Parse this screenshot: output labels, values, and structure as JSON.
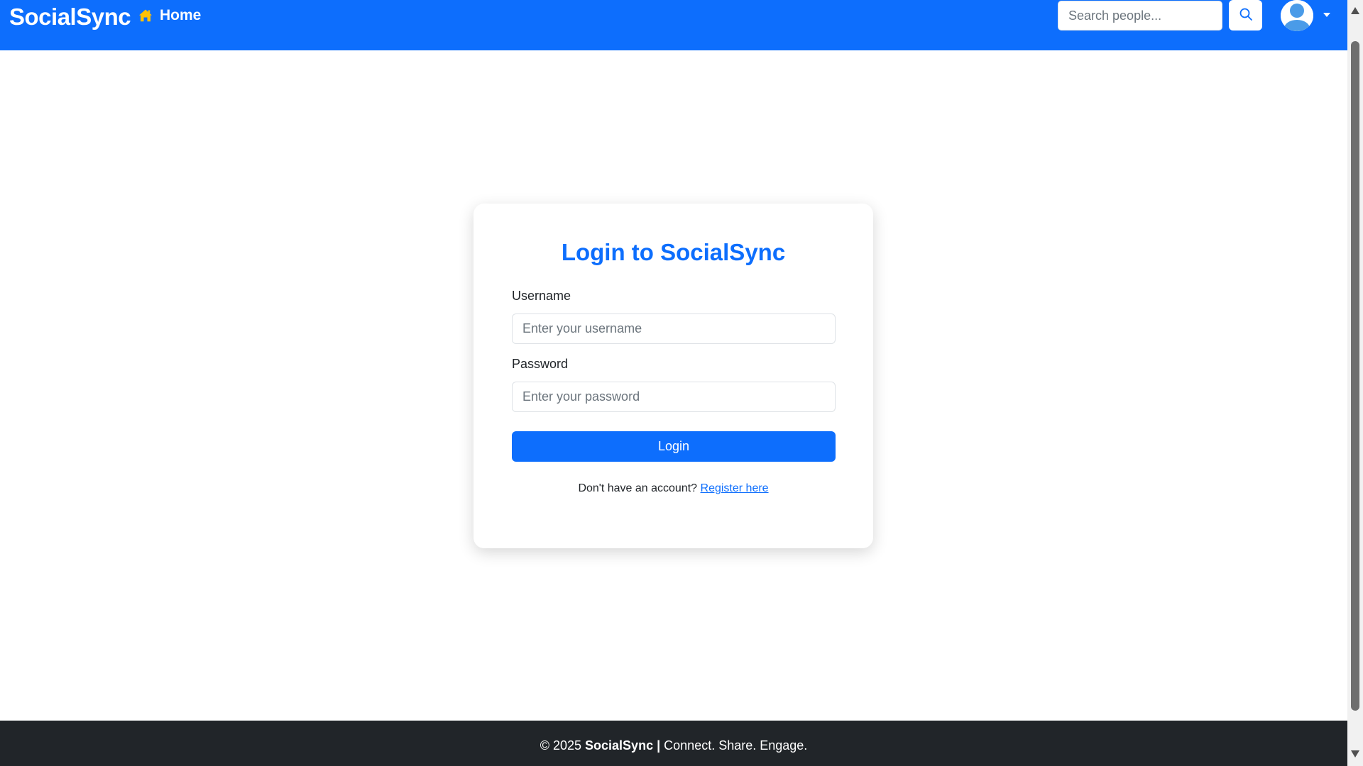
{
  "navbar": {
    "brand": "SocialSync",
    "home_label": "Home",
    "home_icon": "house-icon",
    "search_placeholder": "Search people...",
    "search_icon": "search-icon",
    "avatar_icon": "user-avatar-icon",
    "dropdown_icon": "caret-down-icon"
  },
  "login": {
    "title": "Login to SocialSync",
    "username_label": "Username",
    "username_placeholder": "Enter your username",
    "password_label": "Password",
    "password_placeholder": "Enter your password",
    "submit_label": "Login",
    "register_prompt": "Don't have an account?",
    "register_link": "Register here"
  },
  "footer": {
    "copyright": "© 2025",
    "brand": "SocialSync",
    "separator": "|",
    "tagline": "Connect. Share. Engage."
  },
  "colors": {
    "primary": "#0d6efd",
    "footer_bg": "#212529",
    "home_icon": "#ffc107",
    "text": "#212529"
  }
}
